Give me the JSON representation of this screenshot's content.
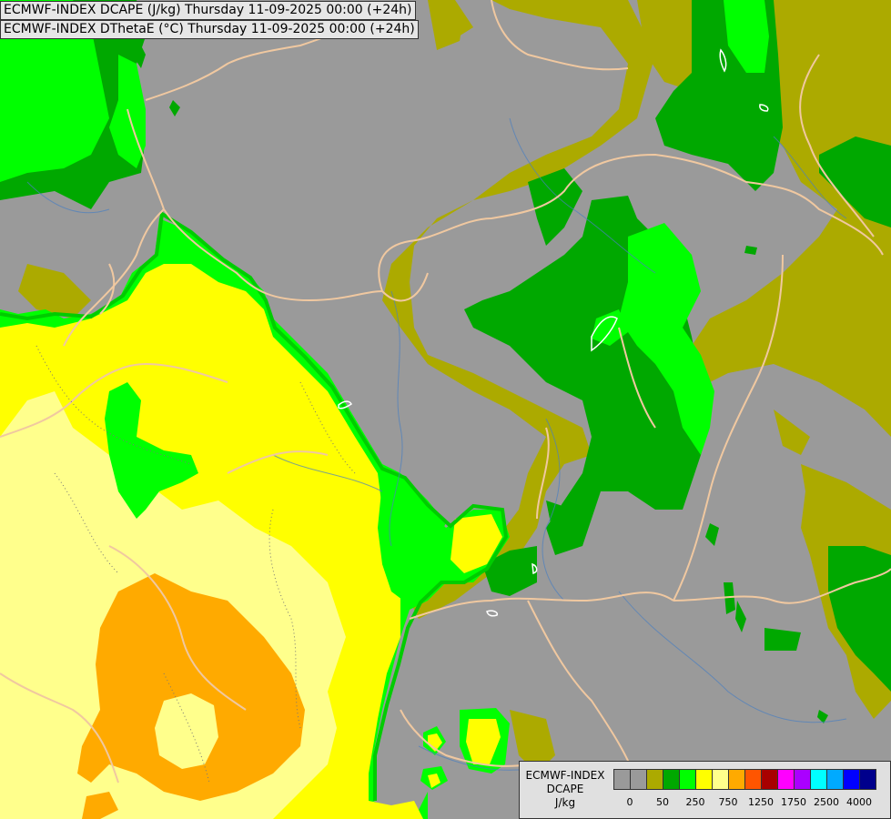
{
  "header": {
    "line1": "ECMWF-INDEX DCAPE (J/kg) Thursday 11-09-2025 00:00 (+24h)",
    "line2": "ECMWF-INDEX DThetaE (°C) Thursday 11-09-2025 00:00 (+24h)"
  },
  "legend": {
    "title": [
      "ECMWF-INDEX",
      "DCAPE",
      "J/kg"
    ],
    "colors": [
      "#9a9a9a",
      "#9a9a9a",
      "#acaa00",
      "#00a800",
      "#00ff00",
      "#ffff00",
      "#ffff8c",
      "#ffaa00",
      "#ff5500",
      "#a80000",
      "#ff00ff",
      "#aa00ff",
      "#00ffff",
      "#00aaff",
      "#0000ff",
      "#00008c"
    ],
    "tick_labels": [
      {
        "label": "0",
        "after_swatch": 1
      },
      {
        "label": "50",
        "after_swatch": 3
      },
      {
        "label": "250",
        "after_swatch": 5
      },
      {
        "label": "750",
        "after_swatch": 7
      },
      {
        "label": "1250",
        "after_swatch": 9
      },
      {
        "label": "1750",
        "after_swatch": 11
      },
      {
        "label": "2500",
        "after_swatch": 13
      },
      {
        "label": "4000",
        "after_swatch": 15
      }
    ]
  }
}
